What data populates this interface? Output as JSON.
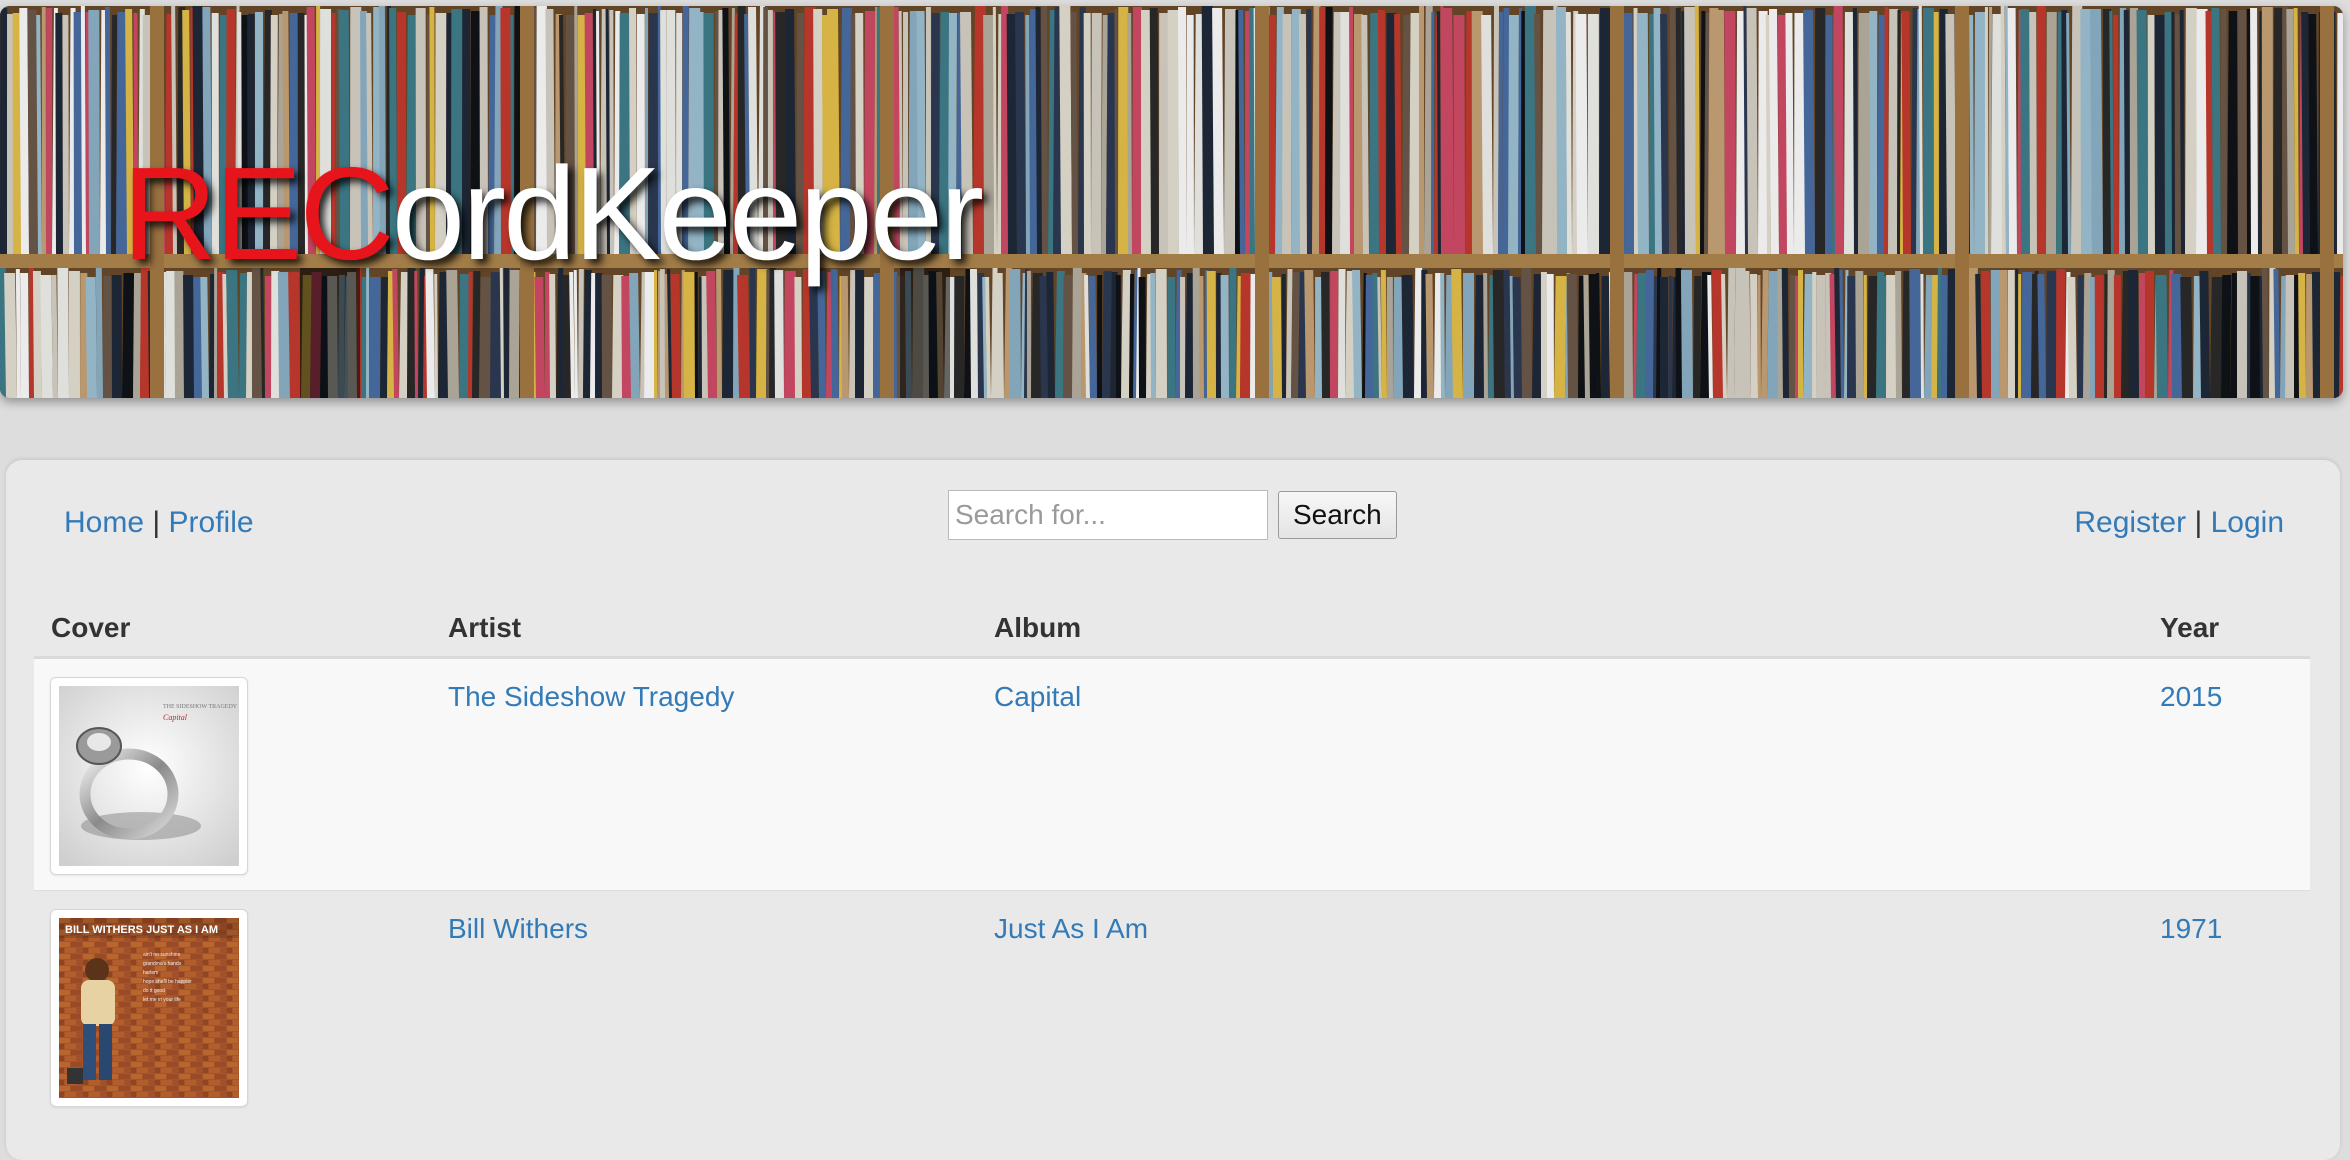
{
  "site": {
    "logo_red": "REC",
    "logo_white": "ordKeeper"
  },
  "nav": {
    "home": "Home",
    "profile": "Profile",
    "separator": "|",
    "register": "Register",
    "login": "Login"
  },
  "search": {
    "placeholder": "Search for...",
    "button_label": "Search"
  },
  "table": {
    "headers": {
      "cover": "Cover",
      "artist": "Artist",
      "album": "Album",
      "year": "Year"
    },
    "rows": [
      {
        "artist": "The Sideshow Tragedy",
        "album": "Capital",
        "year": "2015",
        "cover_text_top": "THE SIDESHOW TRAGEDY",
        "cover_text_sub": "Capital"
      },
      {
        "artist": "Bill Withers",
        "album": "Just As I Am",
        "year": "1971",
        "cover_text_top": "BILL WITHERS  JUST AS I AM"
      }
    ]
  },
  "colors": {
    "link": "#337ab7",
    "logo_red": "#e8141c",
    "panel_bg": "#e9e9e9"
  }
}
